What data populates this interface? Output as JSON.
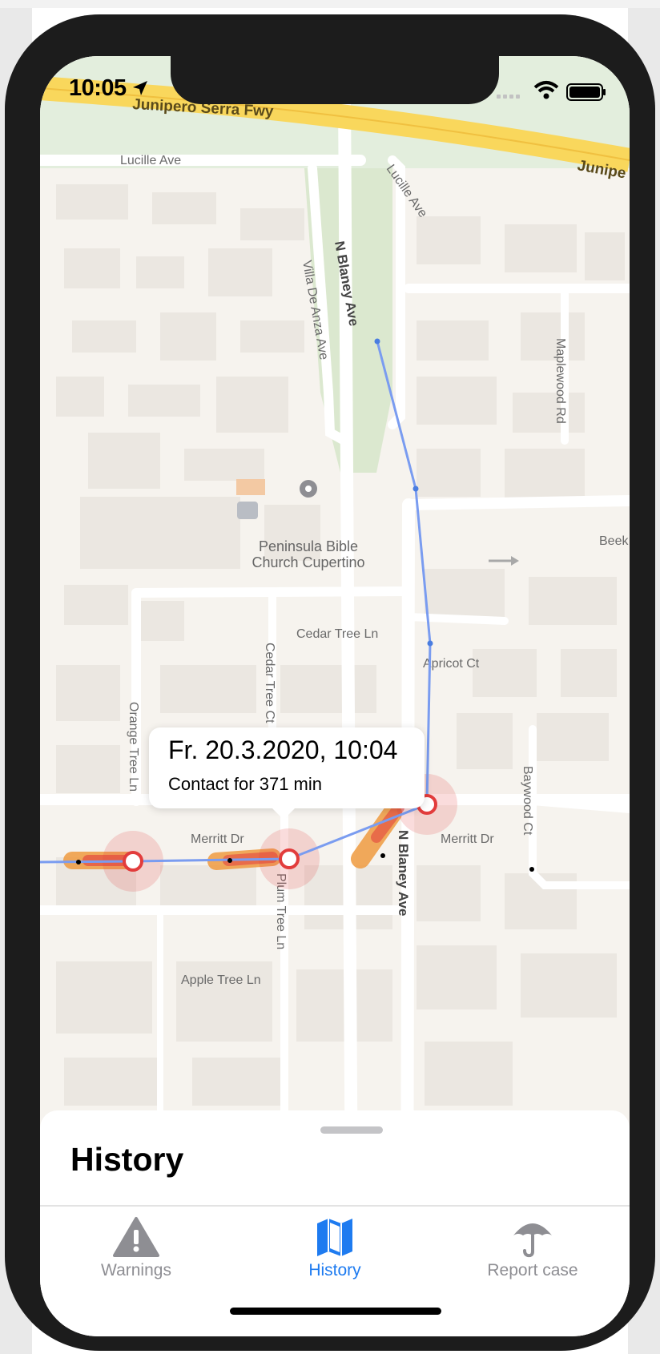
{
  "status_bar": {
    "time": "10:05"
  },
  "map": {
    "labels": {
      "freeway_left": "Junipero Serra Fwy",
      "freeway_right": "Junipe",
      "lucille_ave_w": "Lucille Ave",
      "lucille_ave_e": "Lucille Ave",
      "n_blaney_ave_n": "N Blaney Ave",
      "villa_de_anza": "Villa De Anza Ave",
      "maplewood_rd": "Maplewood Rd",
      "beek": "Beek",
      "poi": "Peninsula Bible Church Cupertino",
      "cedar_tree_ln": "Cedar Tree Ln",
      "cedar_tree_ct": "Cedar Tree Ct",
      "apricot_ct": "Apricot Ct",
      "orange_tree_ln": "Orange Tree Ln",
      "merritt_dr_w": "Merritt Dr",
      "merritt_dr_e": "Merritt Dr",
      "n_blaney_ave_s": "N Blaney Ave",
      "baywood_ct": "Baywood Ct",
      "plum_tree_ln": "Plum Tree Ln",
      "apple_tree_ln": "Apple Tree Ln"
    },
    "colors": {
      "route": "#7a9cf0",
      "contact_hot": "#e23c3c",
      "contact_warm": "#f0a04a",
      "road": "#ffffff",
      "freeway": "#f9d75c",
      "park": "#dbe8cf"
    }
  },
  "callout": {
    "title": "Fr. 20.3.2020, 10:04",
    "subtitle": "Contact for 371 min"
  },
  "sheet": {
    "title": "History"
  },
  "tabs": [
    {
      "label": "Warnings",
      "icon": "warning-triangle-icon",
      "active": false
    },
    {
      "label": "History",
      "icon": "map-icon",
      "active": true
    },
    {
      "label": "Report case",
      "icon": "umbrella-icon",
      "active": false
    }
  ],
  "colors": {
    "active": "#1e7bf0",
    "inactive": "#8e8e93"
  }
}
